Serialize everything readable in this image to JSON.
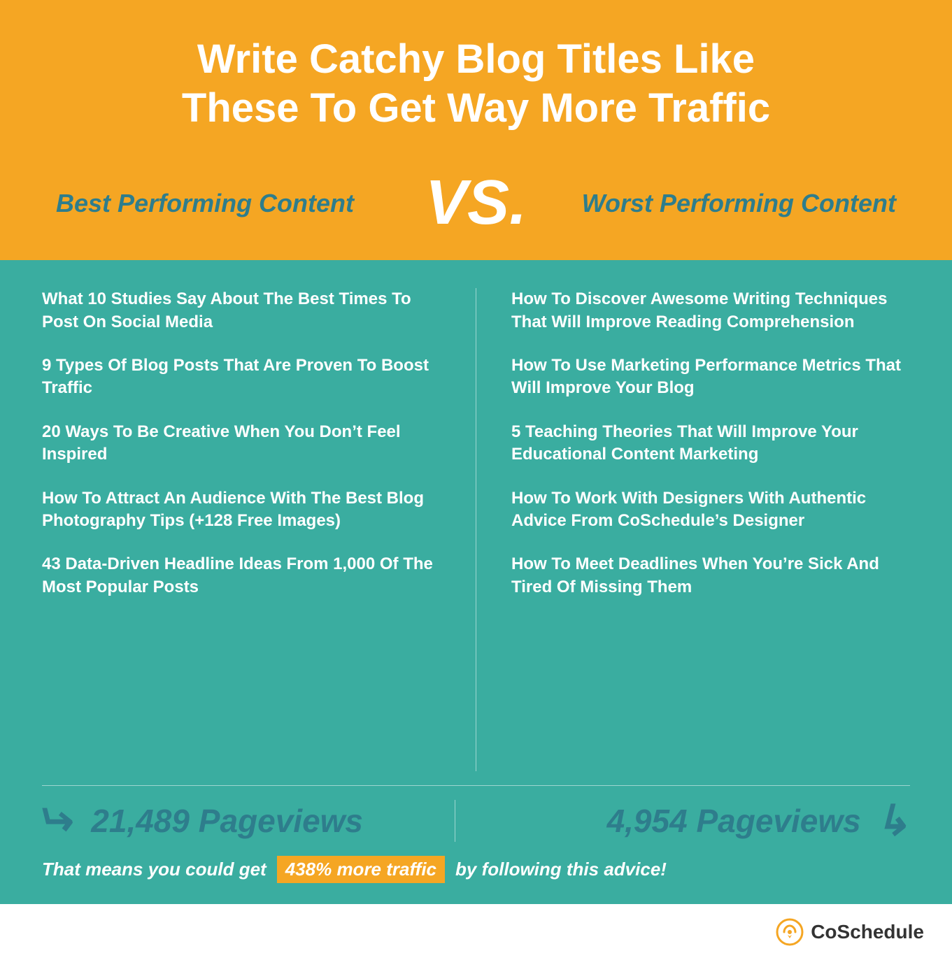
{
  "header": {
    "title_line1": "Write Catchy Blog Titles Like",
    "title_line2": "These To Get Way More Traffic"
  },
  "vs_section": {
    "left_label": "Best Performing Content",
    "vs_text": "VS.",
    "right_label": "Worst Performing Content"
  },
  "left_column": {
    "items": [
      "What 10 Studies Say About The Best Times To Post On Social Media",
      "9 Types Of Blog Posts That Are Proven To Boost Traffic",
      "20 Ways To Be Creative When You Don’t Feel Inspired",
      "How To Attract An Audience With The Best Blog Photography Tips (+128 Free Images)",
      "43 Data-Driven Headline Ideas From 1,000 Of The Most Popular Posts"
    ]
  },
  "right_column": {
    "items": [
      "How To Discover Awesome Writing Techniques That Will Improve Reading Comprehension",
      "How To Use Marketing Performance Metrics That Will Improve Your Blog",
      "5 Teaching Theories That Will Improve Your Educational Content Marketing",
      "How To Work With Designers With Authentic Advice From CoSchedule’s Designer",
      "How To Meet Deadlines When You’re Sick And Tired Of Missing Them"
    ]
  },
  "pageviews": {
    "left": "21,489 Pageviews",
    "right": "4,954 Pageviews"
  },
  "tagline": {
    "before": "That means you could get",
    "highlight": "438% more traffic",
    "after": "by following this advice!"
  },
  "branding": {
    "name": "CoSchedule"
  }
}
